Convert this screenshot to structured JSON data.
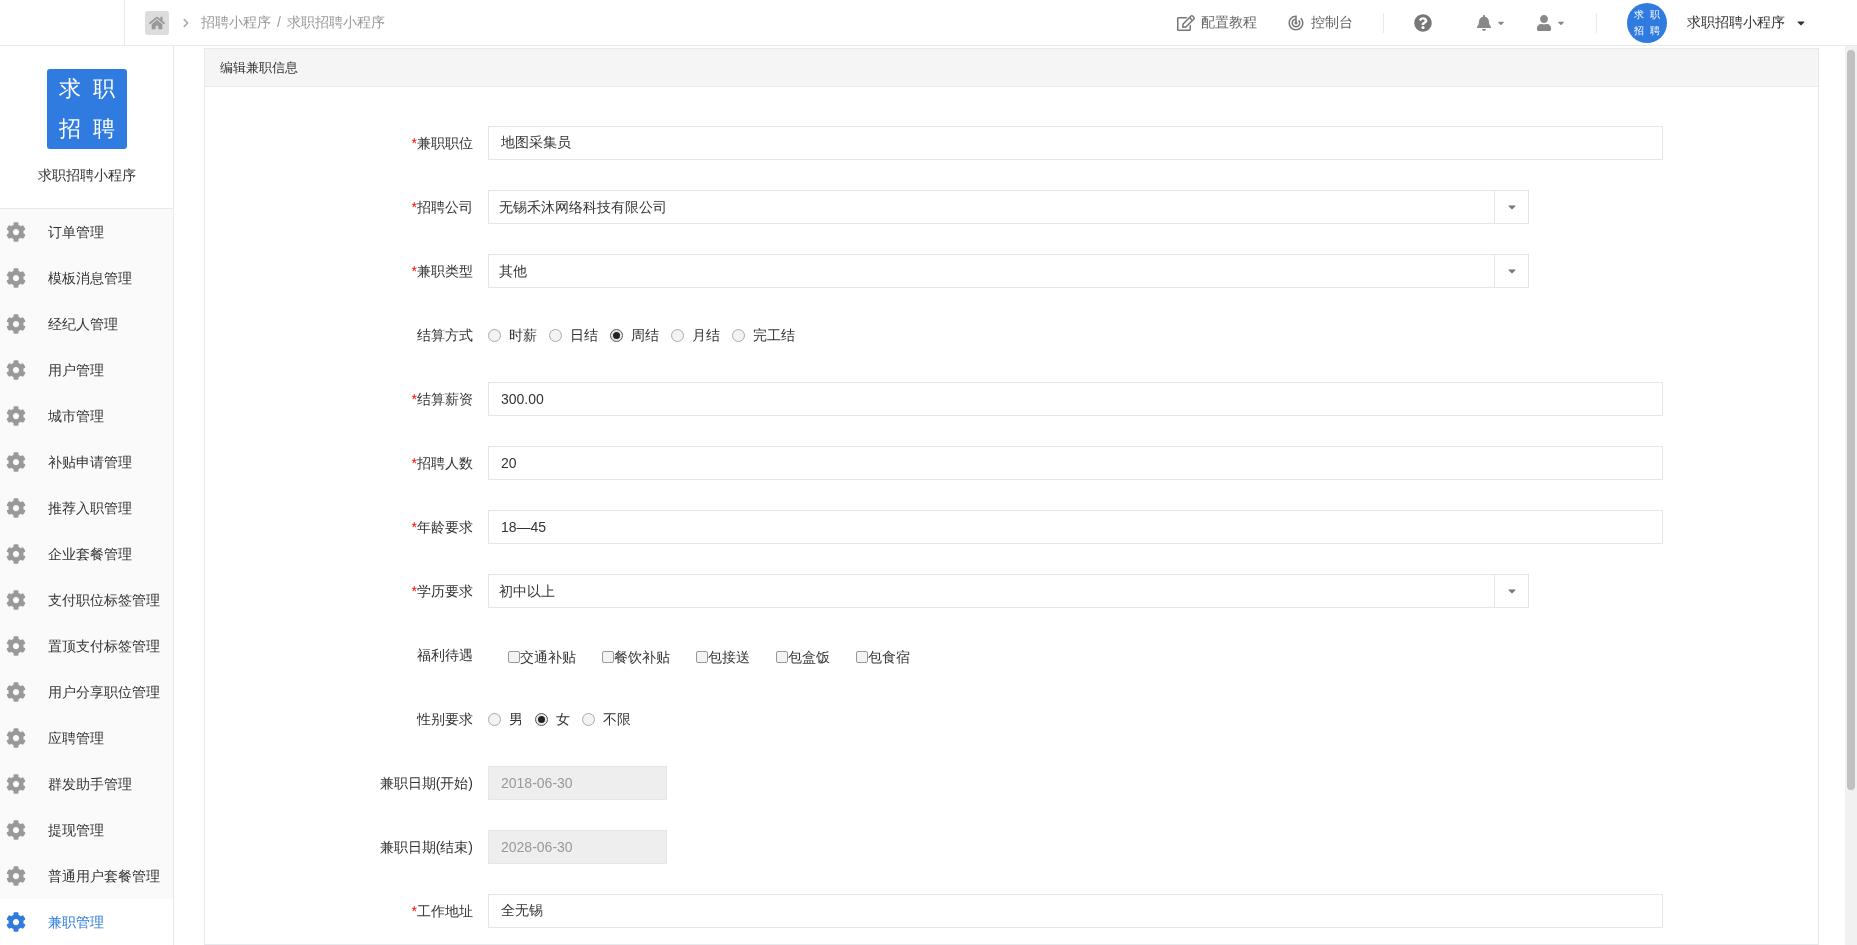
{
  "topbar": {
    "breadcrumb": [
      "招聘小程序",
      "求职招聘小程序"
    ],
    "breadcrumb_separator": "/",
    "links": [
      {
        "kind": "edit",
        "label": "配置教程"
      },
      {
        "kind": "console",
        "label": "控制台"
      }
    ],
    "avatar_chars": [
      "求",
      "职",
      "招",
      "聘"
    ],
    "account": "求职招聘小程序"
  },
  "sidebar": {
    "logo_chars": [
      "求",
      "职",
      "招",
      "聘"
    ],
    "app_name": "求职招聘小程序",
    "items": [
      {
        "label": "订单管理",
        "selected": false
      },
      {
        "label": "模板消息管理",
        "selected": false
      },
      {
        "label": "经纪人管理",
        "selected": false
      },
      {
        "label": "用户管理",
        "selected": false
      },
      {
        "label": "城市管理",
        "selected": false
      },
      {
        "label": "补贴申请管理",
        "selected": false
      },
      {
        "label": "推荐入职管理",
        "selected": false
      },
      {
        "label": "企业套餐管理",
        "selected": false
      },
      {
        "label": "支付职位标签管理",
        "selected": false
      },
      {
        "label": "置顶支付标签管理",
        "selected": false
      },
      {
        "label": "用户分享职位管理",
        "selected": false
      },
      {
        "label": "应聘管理",
        "selected": false
      },
      {
        "label": "群发助手管理",
        "selected": false
      },
      {
        "label": "提现管理",
        "selected": false
      },
      {
        "label": "普通用户套餐管理",
        "selected": false
      },
      {
        "label": "兼职管理",
        "selected": true
      }
    ]
  },
  "panel": {
    "title": "编辑兼职信息",
    "required_mark": "*",
    "fields": [
      {
        "kind": "text",
        "label": "兼职职位",
        "required": true,
        "value": "地图采集员"
      },
      {
        "kind": "select",
        "label": "招聘公司",
        "required": true,
        "value": "无锡禾沐网络科技有限公司"
      },
      {
        "kind": "select",
        "label": "兼职类型",
        "required": true,
        "value": "其他"
      },
      {
        "kind": "radio",
        "label": "结算方式",
        "required": false,
        "options": [
          {
            "label": "时薪",
            "selected": false
          },
          {
            "label": "日结",
            "selected": false
          },
          {
            "label": "周结",
            "selected": true
          },
          {
            "label": "月结",
            "selected": false
          },
          {
            "label": "完工结",
            "selected": false
          }
        ]
      },
      {
        "kind": "text",
        "label": "结算薪资",
        "required": true,
        "value": "300.00"
      },
      {
        "kind": "text",
        "label": "招聘人数",
        "required": true,
        "value": "20"
      },
      {
        "kind": "text",
        "label": "年龄要求",
        "required": true,
        "value": "18—45"
      },
      {
        "kind": "select",
        "label": "学历要求",
        "required": true,
        "value": "初中以上"
      },
      {
        "kind": "checkbox",
        "label": "福利待遇",
        "required": false,
        "options": [
          {
            "label": "交通补贴",
            "checked": false
          },
          {
            "label": "餐饮补贴",
            "checked": false
          },
          {
            "label": "包接送",
            "checked": false
          },
          {
            "label": "包盒饭",
            "checked": false
          },
          {
            "label": "包食宿",
            "checked": false
          }
        ]
      },
      {
        "kind": "radio",
        "label": "性别要求",
        "required": false,
        "options": [
          {
            "label": "男",
            "selected": false
          },
          {
            "label": "女",
            "selected": true
          },
          {
            "label": "不限",
            "selected": false
          }
        ]
      },
      {
        "kind": "date",
        "label": "兼职日期(开始)",
        "required": false,
        "value": "2018-06-30"
      },
      {
        "kind": "date",
        "label": "兼职日期(结束)",
        "required": false,
        "value": "2028-06-30"
      },
      {
        "kind": "text",
        "label": "工作地址",
        "required": true,
        "value": "全无锡"
      }
    ]
  }
}
